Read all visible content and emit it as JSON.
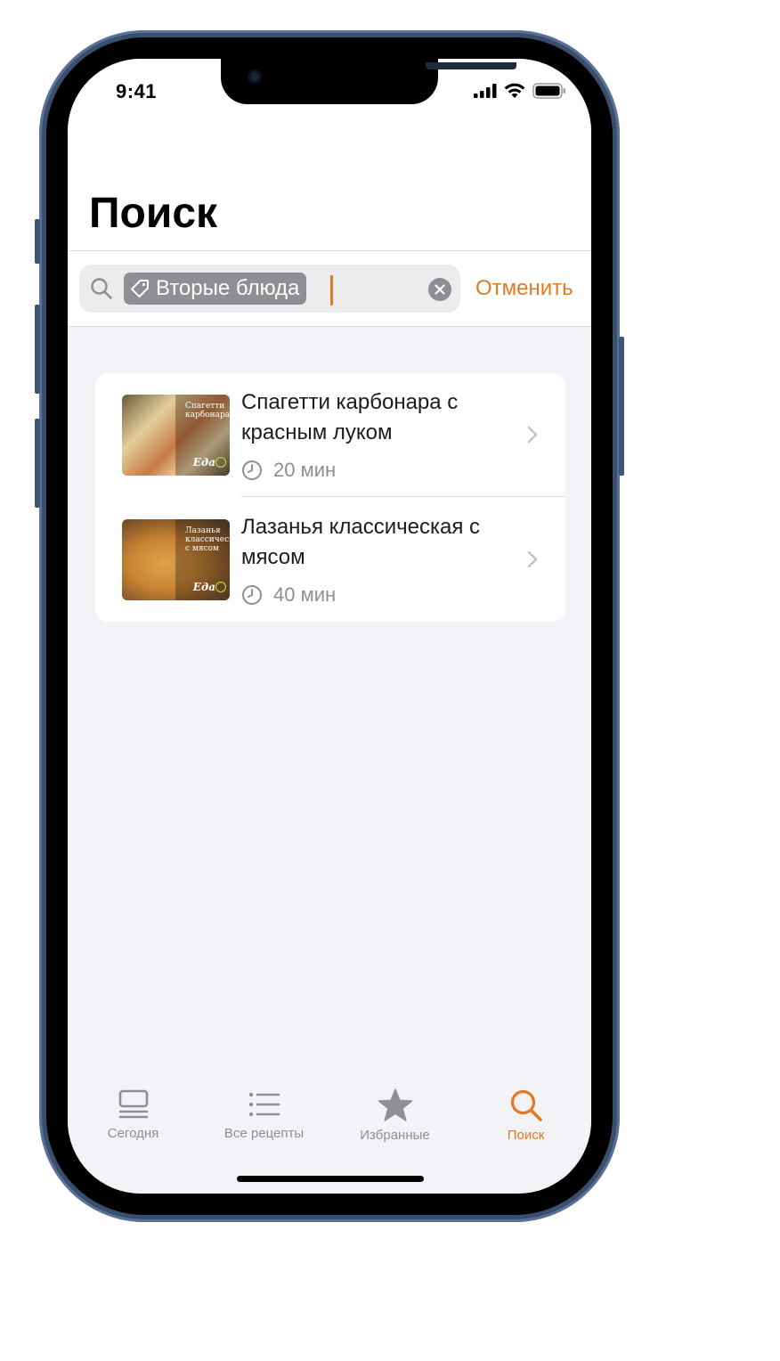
{
  "status_bar": {
    "time": "9:41",
    "icons": [
      "cellular-signal-icon",
      "wifi-icon",
      "battery-icon"
    ]
  },
  "page_title": "Поиск",
  "search": {
    "token_label": "Вторые блюда",
    "token_icon": "tag-icon",
    "cancel_label": "Отменить"
  },
  "results": [
    {
      "title": "Спагетти карбонара с красным луком",
      "time": "20 мин",
      "thumb_caption": "Спагетти карбонара",
      "thumb_logo": "Еда"
    },
    {
      "title": "Лазанья классическая с мясом",
      "time": "40 мин",
      "thumb_caption": "Лазанья классическая с мясом",
      "thumb_logo": "Еда"
    }
  ],
  "tabbar": {
    "tabs": [
      {
        "label": "Сегодня",
        "icon": "today-icon"
      },
      {
        "label": "Все рецепты",
        "icon": "list-icon"
      },
      {
        "label": "Избранные",
        "icon": "star-icon"
      },
      {
        "label": "Поиск",
        "icon": "search-icon",
        "active": true
      }
    ]
  },
  "colors": {
    "accent": "#e07b22",
    "background": "#f2f2f7",
    "secondary_text": "#8e8e93"
  }
}
